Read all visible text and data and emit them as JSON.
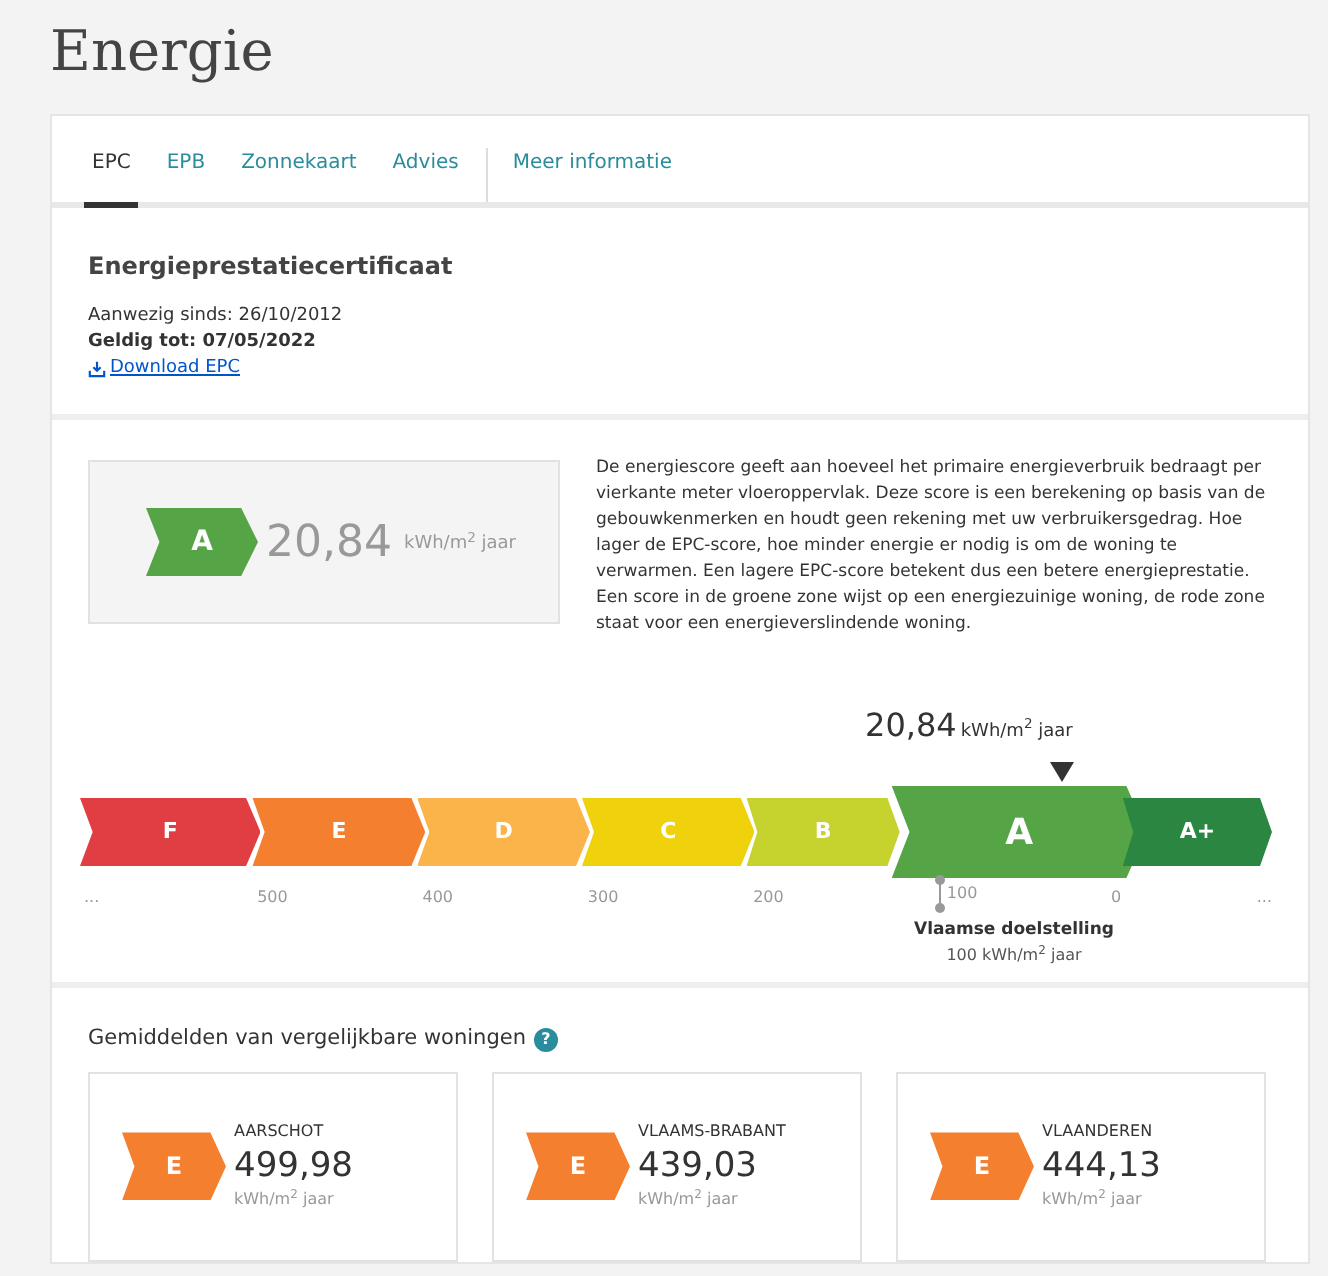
{
  "title": "Energie",
  "tabs": [
    {
      "label": "EPC",
      "selected": true
    },
    {
      "label": "EPB",
      "selected": false
    },
    {
      "label": "Zonnekaart",
      "selected": false
    },
    {
      "label": "Advies",
      "selected": false
    },
    {
      "label": "Meer informatie",
      "selected": false
    }
  ],
  "certificate": {
    "title": "Energieprestatiecertificaat",
    "present_since": "Aanwezig sinds: 26/10/2012",
    "valid_until": "Geldig tot: 07/05/2022",
    "download_link": "Download EPC"
  },
  "score": {
    "label": "A",
    "color": "#55a547",
    "value": "20,84",
    "unit": "kWh/m$^{2}$ jaar"
  },
  "description": "De energiescore geeft aan hoeveel het primaire energieverbruik bedraagt per vierkante meter vloeroppervlak. Deze score is een berekening op basis van de gebouwkenmerken en houdt geen rekening met uw verbruikersgedrag. Hoe lager de EPC-score, hoe minder energie er nodig is om de woning te verwarmen. Een lagere EPC-score betekent dus een betere energieprestatie. Een score in de groene zone wijst op een energiezuinige woning, de rode zone staat voor een energieverslindende woning.",
  "scale": {
    "current": {
      "value": "20,84",
      "unit": "kWh/m$^{2}$ jaar"
    },
    "classes": [
      {
        "label": "F",
        "color": "#e03e42",
        "selected": false,
        "tick": "..."
      },
      {
        "label": "E",
        "color": "#f47f2e",
        "selected": false,
        "tick": "500"
      },
      {
        "label": "D",
        "color": "#fbb44a",
        "selected": false,
        "tick": "400"
      },
      {
        "label": "C",
        "color": "#efd20b",
        "selected": false,
        "tick": "300"
      },
      {
        "label": "B",
        "color": "#c6d22d",
        "selected": false,
        "tick": "200"
      },
      {
        "label": "A",
        "color": "#55a547",
        "selected": true,
        "tick": "100"
      },
      {
        "label": "A+",
        "color": "#2a8641",
        "selected": false,
        "tick": "0"
      }
    ],
    "end_tick": "...",
    "target": {
      "label": "Vlaamse doelstelling",
      "value": "100 kWh/m$^{2}$ jaar"
    }
  },
  "averages": {
    "title": "Gemiddelden van vergelijkbare woningen",
    "help": "?",
    "cards": [
      {
        "region": "AARSCHOT",
        "label": "E",
        "color": "#f47f2e",
        "value": "499,98",
        "unit": "kWh/m$^{2}$ jaar"
      },
      {
        "region": "VLAAMS-BRABANT",
        "label": "E",
        "color": "#f47f2e",
        "value": "439,03",
        "unit": "kWh/m$^{2}$ jaar"
      },
      {
        "region": "VLAANDEREN",
        "label": "E",
        "color": "#f47f2e",
        "value": "444,13",
        "unit": "kWh/m$^{2}$ jaar"
      }
    ]
  }
}
